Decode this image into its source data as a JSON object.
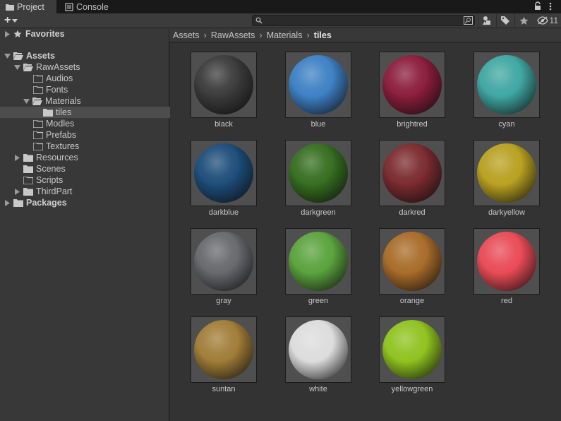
{
  "tabs": [
    {
      "label": "Project",
      "icon": "folder-icon",
      "active": true
    },
    {
      "label": "Console",
      "icon": "console-icon",
      "active": false
    }
  ],
  "toolbar": {
    "add_label": "+",
    "search_placeholder": "",
    "hidden_count": "11"
  },
  "tree": {
    "favorites": "Favorites",
    "assets": "Assets",
    "rawassets": "RawAssets",
    "audios": "Audios",
    "fonts": "Fonts",
    "materials": "Materials",
    "tiles": "tiles",
    "modles": "Modles",
    "prefabs": "Prefabs",
    "textures": "Textures",
    "resources": "Resources",
    "scenes": "Scenes",
    "scripts": "Scripts",
    "thirdpart": "ThirdPart",
    "packages": "Packages"
  },
  "breadcrumb": [
    "Assets",
    "RawAssets",
    "Materials",
    "tiles"
  ],
  "materials": [
    {
      "name": "black",
      "color": "#3a3a3a"
    },
    {
      "name": "blue",
      "color": "#3d80c4"
    },
    {
      "name": "brightred",
      "color": "#8a1c3c"
    },
    {
      "name": "cyan",
      "color": "#3fa6a2"
    },
    {
      "name": "darkblue",
      "color": "#1c4c78"
    },
    {
      "name": "darkgreen",
      "color": "#356d1f"
    },
    {
      "name": "darkred",
      "color": "#7a2a2e"
    },
    {
      "name": "darkyellow",
      "color": "#b8a020"
    },
    {
      "name": "gray",
      "color": "#66686c"
    },
    {
      "name": "green",
      "color": "#5aa23c"
    },
    {
      "name": "orange",
      "color": "#a86b28"
    },
    {
      "name": "red",
      "color": "#e84a55"
    },
    {
      "name": "suntan",
      "color": "#a07c36"
    },
    {
      "name": "white",
      "color": "#dcdcdc"
    },
    {
      "name": "yellowgreen",
      "color": "#8ec21e"
    }
  ]
}
